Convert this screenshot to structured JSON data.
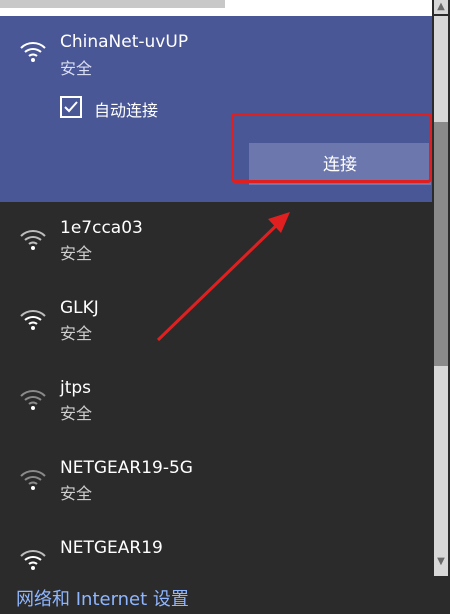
{
  "selected_network": {
    "name": "ChinaNet-uvUP",
    "security": "安全",
    "auto_connect_label": "自动连接",
    "auto_connect_checked": true,
    "connect_label": "连接"
  },
  "networks": [
    {
      "name": "1e7cca03",
      "security": "安全"
    },
    {
      "name": "GLKJ",
      "security": "安全"
    },
    {
      "name": "jtps",
      "security": "安全"
    },
    {
      "name": "NETGEAR19-5G",
      "security": "安全"
    },
    {
      "name": "NETGEAR19",
      "security": ""
    }
  ],
  "footer": {
    "settings_link": "网络和 Internet 设置"
  },
  "scrollbar": {
    "up_arrow": "▲",
    "down_arrow": "▼"
  },
  "icons": {
    "wifi": "wifi-icon",
    "check": "check-icon"
  },
  "colors": {
    "selected_bg": "#4a5796",
    "panel_bg": "#2b2b2b",
    "button_bg": "#6c78ad",
    "link": "#8fb6ff",
    "annotation": "#e02020"
  }
}
